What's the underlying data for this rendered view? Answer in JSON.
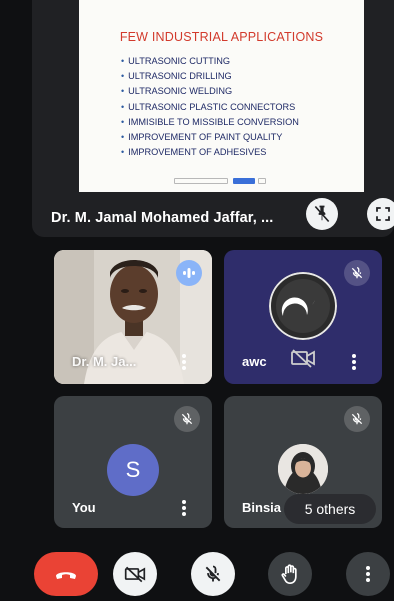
{
  "presentation": {
    "slide": {
      "title": "FEW INDUSTRIAL APPLICATIONS",
      "items": [
        "ULTRASONIC CUTTING",
        "ULTRASONIC DRILLING",
        "ULTRASONIC WELDING",
        "ULTRASONIC PLASTIC CONNECTORS",
        "IMMISIBLE TO MISSIBLE CONVERSION",
        "IMPROVEMENT OF PAINT QUALITY",
        "IMPROVEMENT OF ADHESIVES"
      ]
    },
    "presenter_name": "Dr. M. Jamal Mohamed Jaffar, ..."
  },
  "participants": [
    {
      "name": "Dr. M. Ja...",
      "state": "speaking"
    },
    {
      "name": "awc",
      "state": "muted"
    },
    {
      "name": "You",
      "avatar_letter": "S",
      "state": "muted"
    },
    {
      "name": "Binsia",
      "state": "muted"
    }
  ],
  "others_chip": "5 others",
  "colors": {
    "end_call": "#ea4335",
    "avatar_s": "#5f6dc8",
    "speaking": "#8ab4f8",
    "slide_title": "#d23a2c"
  },
  "icons": {
    "pin": "pin-off-icon",
    "fullscreen": "fullscreen-icon",
    "end_call": "phone-hangup-icon",
    "camera": "camera-off-icon",
    "mic": "mic-off-icon",
    "hand": "raise-hand-icon",
    "more": "more-vert-icon"
  }
}
